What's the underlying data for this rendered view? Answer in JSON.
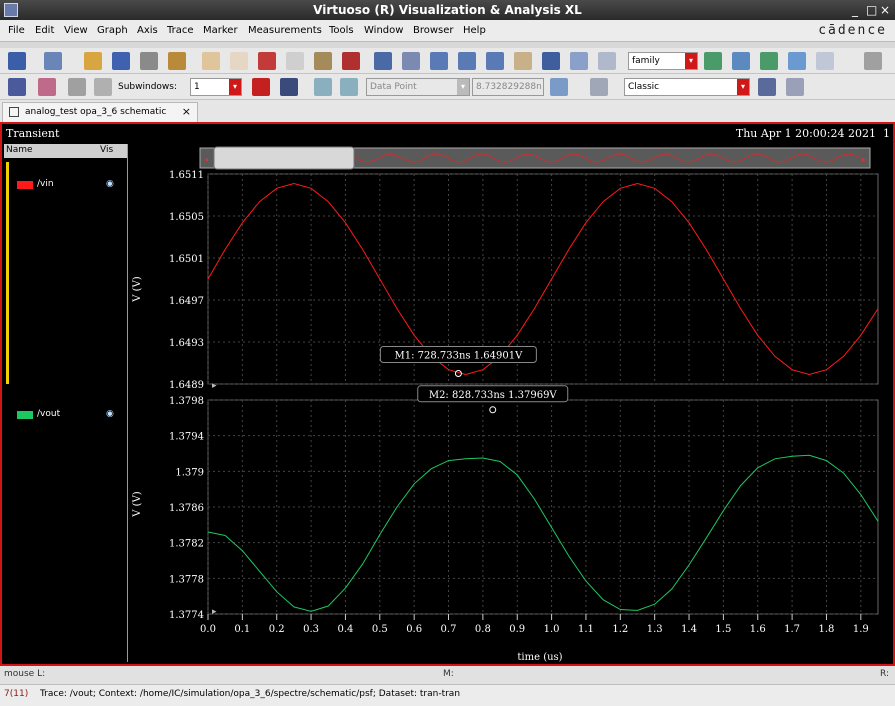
{
  "window": {
    "title": "Virtuoso (R) Visualization & Analysis XL",
    "min": "_",
    "max": "□",
    "close": "×"
  },
  "menu": {
    "items": [
      "File",
      "Edit",
      "View",
      "Graph",
      "Axis",
      "Trace",
      "Marker",
      "Measurements",
      "Tools",
      "Window",
      "Browser",
      "Help"
    ],
    "brand": "cādence"
  },
  "toolbar": {
    "family_combo": "family",
    "subwindows_label": "Subwindows:",
    "subwindows_value": "1",
    "data_point_combo": "Data Point",
    "data_point_value": "8.732829288n",
    "style_combo": "Classic"
  },
  "tab": {
    "label": "analog_test opa_3_6 schematic",
    "close": "×"
  },
  "plot": {
    "analysis": "Transient",
    "datetime": "Thu Apr 1 20:00:24 2021",
    "window_num": "1"
  },
  "legend": {
    "col_name": "Name",
    "col_vis": "Vis",
    "traces": [
      {
        "name": "/vin",
        "color": "#ff1a1a"
      },
      {
        "name": "/vout",
        "color": "#1ec860"
      }
    ]
  },
  "markers": [
    {
      "label": "M1: 728.733ns 1.64901V"
    },
    {
      "label": "M2: 828.733ns 1.37969V"
    }
  ],
  "chart_data": [
    {
      "type": "line",
      "series": [
        {
          "name": "/vin",
          "x": [
            0,
            0.05,
            0.1,
            0.15,
            0.2,
            0.25,
            0.3,
            0.35,
            0.4,
            0.45,
            0.5,
            0.55,
            0.6,
            0.65,
            0.7,
            0.75,
            0.8,
            0.85,
            0.9,
            0.95,
            1.0,
            1.05,
            1.1,
            1.15,
            1.2,
            1.25,
            1.3,
            1.35,
            1.4,
            1.45,
            1.5,
            1.55,
            1.6,
            1.65,
            1.7,
            1.75,
            1.8,
            1.85,
            1.9,
            1.95
          ],
          "y": [
            1.65,
            1.65031,
            1.65059,
            1.65081,
            1.65095,
            1.651,
            1.65095,
            1.65081,
            1.65059,
            1.65031,
            1.65,
            1.64969,
            1.64941,
            1.64919,
            1.64905,
            1.649,
            1.64905,
            1.64919,
            1.64941,
            1.64969,
            1.65,
            1.65031,
            1.65059,
            1.65081,
            1.65095,
            1.651,
            1.65095,
            1.65081,
            1.65059,
            1.65031,
            1.65,
            1.64969,
            1.64941,
            1.64919,
            1.64905,
            1.649,
            1.64905,
            1.64919,
            1.64941,
            1.64969
          ]
        }
      ],
      "ylabel": "V (V)",
      "ytick_labels": [
        "1.6511",
        "1.6505",
        "1.6501",
        "1.6497",
        "1.6493",
        "1.6489"
      ],
      "ylim": [
        1.6489,
        1.6511
      ]
    },
    {
      "type": "line",
      "series": [
        {
          "name": "/vout",
          "x": [
            0,
            0.05,
            0.1,
            0.15,
            0.2,
            0.25,
            0.3,
            0.35,
            0.4,
            0.45,
            0.5,
            0.55,
            0.6,
            0.65,
            0.7,
            0.75,
            0.8,
            0.85,
            0.9,
            0.95,
            1.0,
            1.05,
            1.1,
            1.15,
            1.2,
            1.25,
            1.3,
            1.35,
            1.4,
            1.45,
            1.5,
            1.55,
            1.6,
            1.65,
            1.7,
            1.75,
            1.8,
            1.85,
            1.9,
            1.95
          ],
          "y": [
            1.37832,
            1.37828,
            1.37811,
            1.37788,
            1.37765,
            1.37748,
            1.37743,
            1.37749,
            1.37769,
            1.37796,
            1.37829,
            1.3786,
            1.37886,
            1.37903,
            1.37912,
            1.37914,
            1.37915,
            1.37911,
            1.37896,
            1.37869,
            1.37837,
            1.37805,
            1.37777,
            1.37756,
            1.37745,
            1.37744,
            1.37751,
            1.37768,
            1.37795,
            1.37825,
            1.37856,
            1.37884,
            1.37904,
            1.37914,
            1.37917,
            1.37918,
            1.37912,
            1.37898,
            1.37874,
            1.37844
          ]
        }
      ],
      "ylabel": "V (V)",
      "ytick_labels": [
        "1.3798",
        "1.3794",
        "1.379",
        "1.3786",
        "1.3782",
        "1.3778",
        "1.3774"
      ],
      "ylim": [
        1.3774,
        1.3798
      ],
      "xlabel": "time (us)",
      "xtick_labels": [
        "0.0",
        "0.1",
        "0.2",
        "0.3",
        "0.4",
        "0.5",
        "0.6",
        "0.7",
        "0.8",
        "0.9",
        "1.0",
        "1.1",
        "1.2",
        "1.3",
        "1.4",
        "1.5",
        "1.6",
        "1.7",
        "1.8",
        "1.9"
      ],
      "xlim": [
        0,
        1.95
      ]
    }
  ],
  "status": {
    "mouse_l": "mouse L:",
    "mouse_m": "M:",
    "mouse_r": "R:",
    "count": "7(11)",
    "message": "Trace: /vout; Context: /home/IC/simulation/opa_3_6/spectre/schematic/psf; Dataset: tran-tran"
  }
}
